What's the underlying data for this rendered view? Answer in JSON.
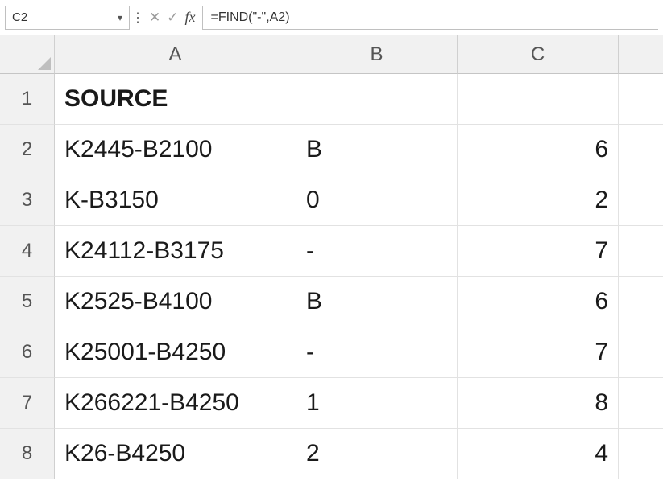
{
  "formula_bar": {
    "name_box": "C2",
    "cancel_icon": "✕",
    "enter_icon": "✓",
    "fx_label": "fx",
    "formula": "=FIND(\"-\",A2)"
  },
  "columns": [
    "A",
    "B",
    "C",
    ""
  ],
  "row_numbers": [
    "1",
    "2",
    "3",
    "4",
    "5",
    "6",
    "7",
    "8"
  ],
  "cells": {
    "r1": {
      "A": "SOURCE",
      "B": "",
      "C": ""
    },
    "r2": {
      "A": "K2445-B2100",
      "B": "B",
      "C": "6"
    },
    "r3": {
      "A": "K-B3150",
      "B": "0",
      "C": "2"
    },
    "r4": {
      "A": "K24112-B3175",
      "B": "-",
      "C": "7"
    },
    "r5": {
      "A": "K2525-B4100",
      "B": "B",
      "C": "6"
    },
    "r6": {
      "A": "K25001-B4250",
      "B": "-",
      "C": "7"
    },
    "r7": {
      "A": "K266221-B4250",
      "B": "1",
      "C": "8"
    },
    "r8": {
      "A": "K26-B4250",
      "B": "2",
      "C": "4"
    }
  }
}
